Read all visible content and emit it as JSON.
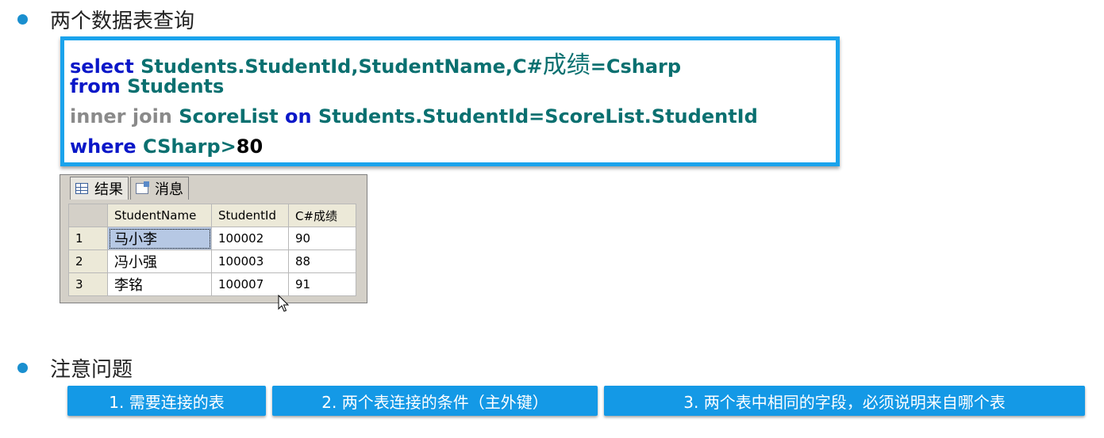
{
  "section1": {
    "title": "两个数据表查询"
  },
  "sql": {
    "line1": {
      "kw": "select",
      "rest": "Students.StudentId,StudentName,C#",
      "cn": "成绩",
      "tail": "=Csharp"
    },
    "line2": {
      "kw": "from",
      "rest": "Students"
    },
    "line3": {
      "kw_gray": "inner join",
      "t1": "ScoreList",
      "kw_on": "on",
      "cond": "Students.StudentId=ScoreList.StudentId"
    },
    "line4": {
      "kw": "where",
      "rest": "CSharp",
      "op": ">",
      "val": "80"
    }
  },
  "results": {
    "tabs": [
      {
        "label": "结果",
        "icon": "table-grid-icon"
      },
      {
        "label": "消息",
        "icon": "message-icon"
      }
    ],
    "columns": [
      "StudentName",
      "StudentId",
      "C#成绩"
    ],
    "rows": [
      {
        "num": "1",
        "name": "马小李",
        "id": "100002",
        "score": "90"
      },
      {
        "num": "2",
        "name": "冯小强",
        "id": "100003",
        "score": "88"
      },
      {
        "num": "3",
        "name": "李铭",
        "id": "100007",
        "score": "91"
      }
    ]
  },
  "section2": {
    "title": "注意问题"
  },
  "notes": [
    "1. 需要连接的表",
    "2. 两个表连接的条件（主外键）",
    "3. 两个表中相同的字段，必须说明来自哪个表"
  ],
  "colors": {
    "accent": "#1499e6",
    "sql_border": "#1aa3ec",
    "sql_keyword": "#0a17c8",
    "sql_ident": "#0a7070"
  }
}
